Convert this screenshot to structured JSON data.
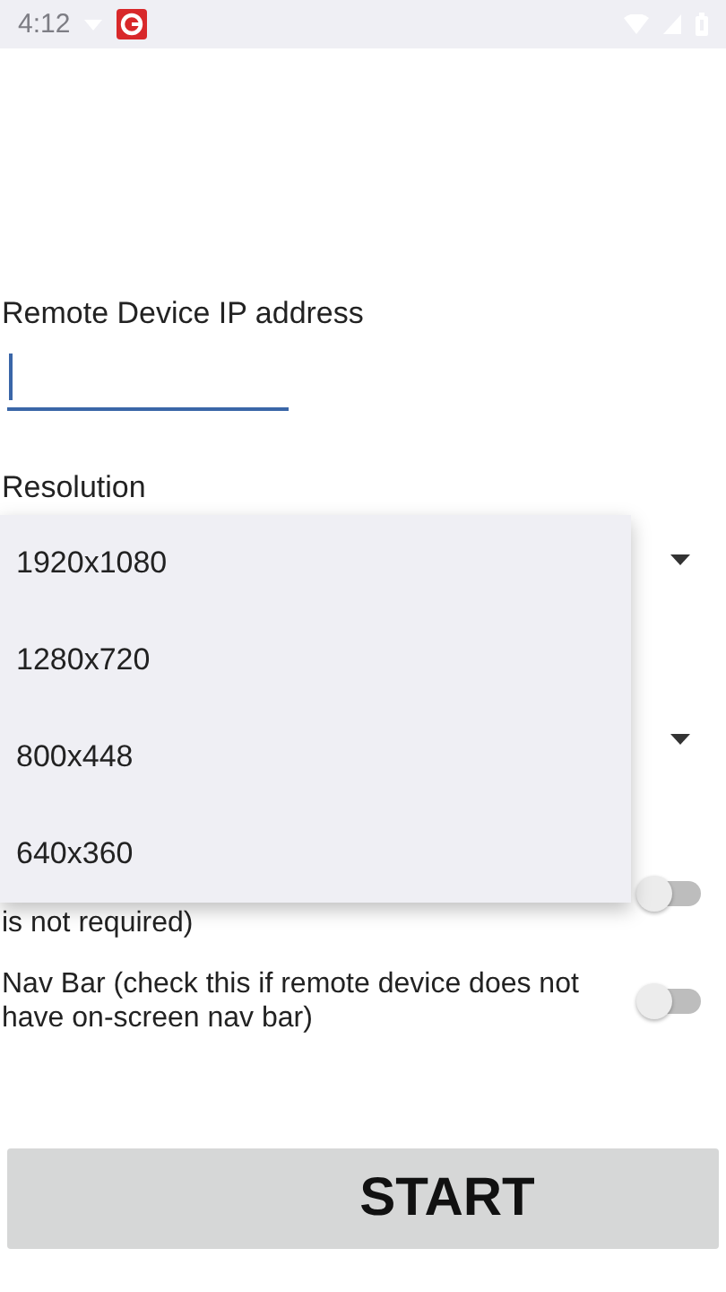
{
  "status_bar": {
    "time": "4:12"
  },
  "ip_field": {
    "label": "Remote Device IP address"
  },
  "resolution": {
    "label": "Resolution",
    "expanded": true,
    "options": [
      {
        "label": "1920x1080",
        "selected": false
      },
      {
        "label": "1280x720",
        "selected": false
      },
      {
        "label": "800x448",
        "selected": false
      },
      {
        "label": "640x360",
        "selected": false
      }
    ]
  },
  "switches": [
    {
      "label": "is not required)",
      "on": false
    },
    {
      "label": "Nav Bar (check this if remote device does not have on-screen nav bar)",
      "on": false
    }
  ],
  "start_button": {
    "label": "START"
  }
}
